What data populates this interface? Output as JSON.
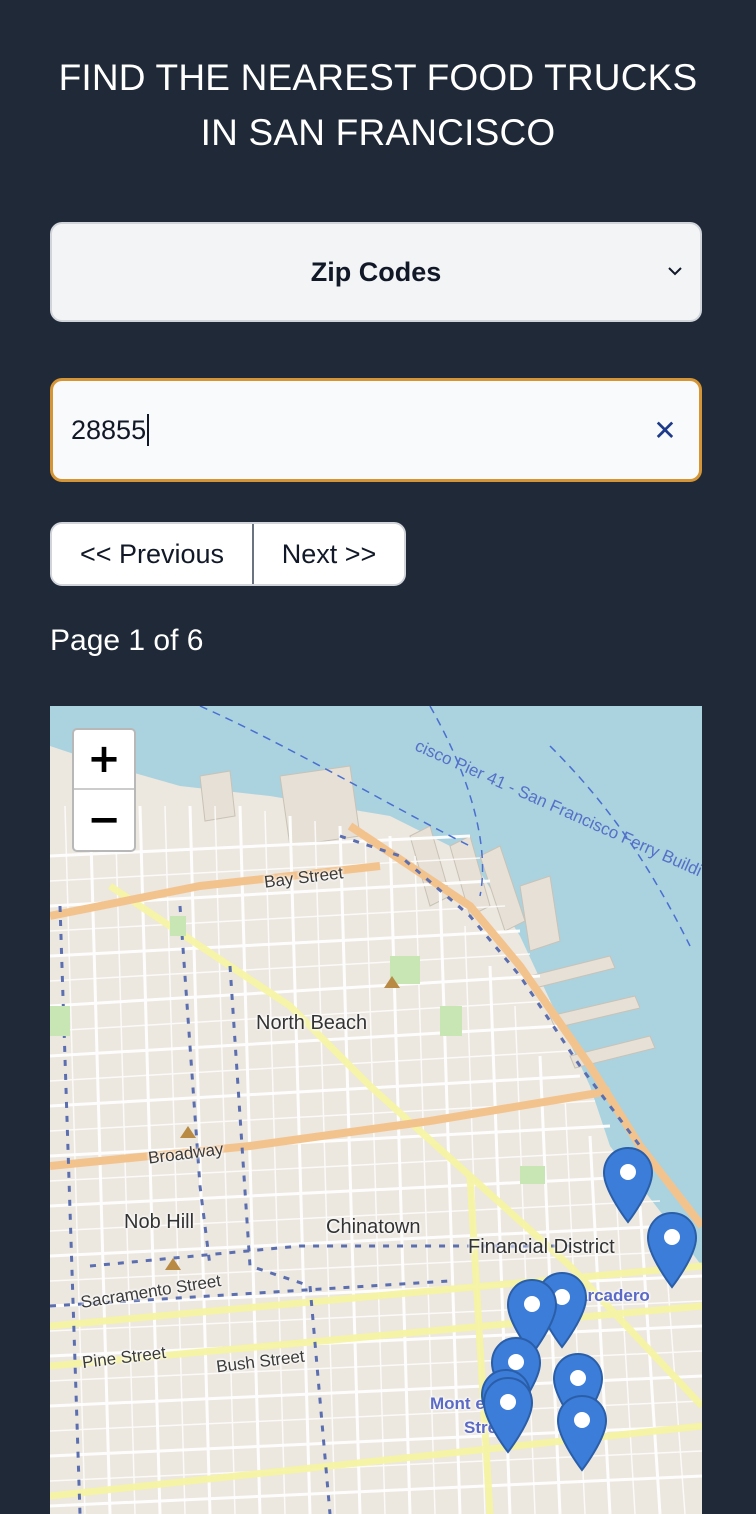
{
  "header": {
    "title_line1": "FIND THE NEAREST FOOD TRUCKS",
    "title_line2": "IN SAN FRANCISCO"
  },
  "filter": {
    "selected": "Zip Codes"
  },
  "search": {
    "value": "28855"
  },
  "pagination": {
    "prev_label": "<< Previous",
    "next_label": "Next >>",
    "page_info": "Page 1 of 6"
  },
  "map": {
    "zoom_in": "+",
    "zoom_out": "−",
    "labels": {
      "bay_street": "Bay Street",
      "north_beach": "North Beach",
      "broadway": "Broadway",
      "nob_hill": "Nob Hill",
      "chinatown": "Chinatown",
      "financial_district": "Financial District",
      "embarcadero": "arcadero",
      "sacramento_street": "Sacramento Street",
      "pine_street": "Pine Street",
      "bush_street": "Bush Street",
      "montgomery": "Mont      ery",
      "montgomery_2": "Stre",
      "ferry": "cisco Pier 41 - San Francisco Ferry Buildi"
    },
    "marker_count": 9
  },
  "colors": {
    "background": "#1f2937",
    "accent_border": "#d69535",
    "marker": "#3b7dd8",
    "water": "#aad3df"
  }
}
